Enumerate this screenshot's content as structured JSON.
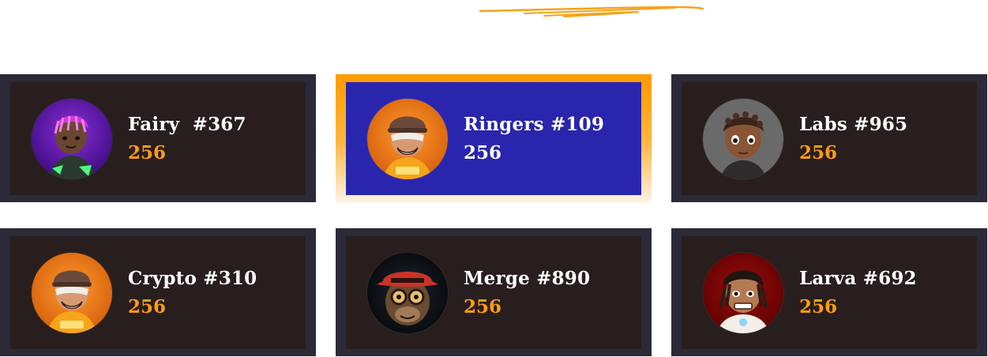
{
  "cards": [
    {
      "name": "Fairy  #367",
      "score": "256",
      "avatar": "fairy-avatar",
      "featured": false
    },
    {
      "name": "Ringers #109",
      "score": "256",
      "avatar": "ringers-avatar",
      "featured": true
    },
    {
      "name": "Labs #965",
      "score": "256",
      "avatar": "labs-avatar",
      "featured": false
    },
    {
      "name": "Crypto #310",
      "score": "256",
      "avatar": "crypto-avatar",
      "featured": false
    },
    {
      "name": "Merge #890",
      "score": "256",
      "avatar": "merge-avatar",
      "featured": false
    },
    {
      "name": "Larva #692",
      "score": "256",
      "avatar": "larva-avatar",
      "featured": false
    }
  ],
  "colors": {
    "card_border": "#2a2a38",
    "card_bg": "#281e1e",
    "featured_bg": "#2a25ad",
    "featured_border": "#ff9b00",
    "score_color": "#ff9d12",
    "name_color": "#ffffff",
    "underline_color": "#f5a21a"
  }
}
